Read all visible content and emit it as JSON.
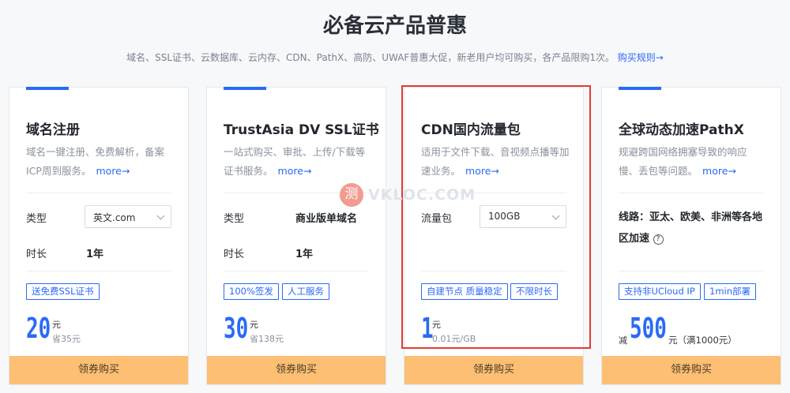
{
  "page": {
    "title": "必备云产品普惠",
    "subtitle": "域名、SSL证书、云数据库、云内存、CDN、PathX、高防、UWAF普惠大促，新老用户均可购买，各产品限购1次。",
    "rules_link": "购买规则→"
  },
  "watermark": {
    "icon_char": "测",
    "text": "VKLOC.COM"
  },
  "cards": [
    {
      "title": "域名注册",
      "desc": "域名一键注册、免费解析，备案ICP周到服务。",
      "more": "more→",
      "rows": [
        {
          "label": "类型",
          "value": "英文.com"
        },
        {
          "label": "时长",
          "value": "1年"
        }
      ],
      "tags": [
        "送免费SSL证书"
      ],
      "price": "20",
      "unit": "元",
      "sub_price": "省35元",
      "button": "领券购买"
    },
    {
      "title": "TrustAsia DV SSL证书",
      "desc": "一站式购买、审批、上传/下载等证书服务。",
      "more": "more→",
      "rows": [
        {
          "label": "类型",
          "value": "商业版单域名"
        },
        {
          "label": "时长",
          "value": "1年"
        }
      ],
      "tags": [
        "100%签发",
        "人工服务"
      ],
      "price": "30",
      "unit": "元",
      "sub_price": "省138元",
      "button": "领券购买"
    },
    {
      "title": "CDN国内流量包",
      "desc": "适用于文件下载、音视频点播等加速业务。",
      "more": "more→",
      "rows": [
        {
          "label": "流量包",
          "value": "100GB"
        }
      ],
      "tags": [
        "自建节点 质量稳定",
        "不限时长"
      ],
      "price": "1",
      "unit": "元",
      "sub_price": "0.01元/GB",
      "button": "领券购买"
    },
    {
      "title": "全球动态加速PathX",
      "desc": "规避跨国网络拥塞导致的响应慢、丢包等问题。",
      "more": "more→",
      "line": "线路：亚太、欧美、非洲等各地区加速",
      "help_icon": "?",
      "tags": [
        "支持非UCloud IP",
        "1min部署"
      ],
      "prefix": "减",
      "price": "500",
      "unit": "元（满1000元）",
      "button": "领券购买"
    }
  ]
}
